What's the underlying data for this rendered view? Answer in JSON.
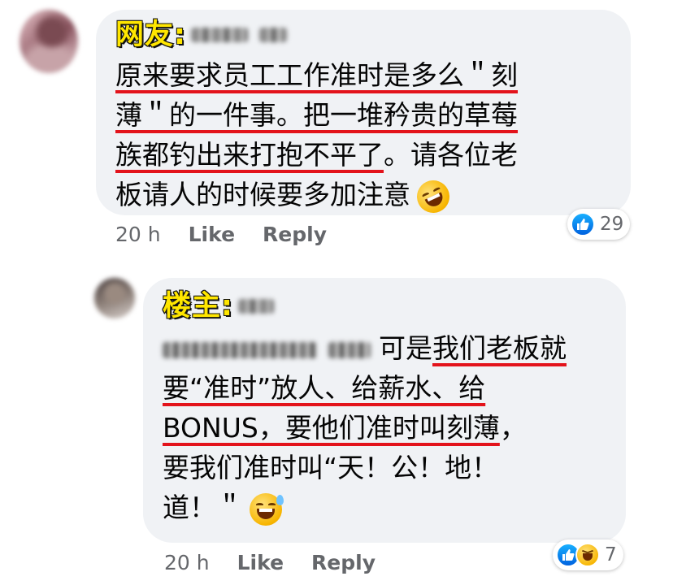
{
  "comments": [
    {
      "label": "网友:",
      "lines": [
        [
          "原来要求员工工作准时是多么＂刻"
        ],
        [
          "薄＂的一件事。把一堆矜贵的草莓"
        ],
        [
          "族都钓出来打抱不平了",
          "。请各位老"
        ],
        [
          "板请人的时候要多加注意"
        ]
      ],
      "emoji": "rolling-on-floor-laughing-emoji",
      "time": "20 h",
      "like_label": "Like",
      "reply_label": "Reply",
      "reaction_count": "29"
    },
    {
      "label": "楼主:",
      "lines": [
        [
          "可是",
          "我们老板就"
        ],
        [
          "要“准时”放人、给薪水、给"
        ],
        [
          "BONUS，要他们准时叫刻薄",
          "，"
        ],
        [
          "要我们准时叫“天！公！地！"
        ],
        [
          "道！＂"
        ]
      ],
      "emoji": "grinning-sweat-emoji",
      "time": "20 h",
      "like_label": "Like",
      "reply_label": "Reply",
      "reaction_count": "7"
    }
  ],
  "colors": {
    "bubble": "#f0f2f5",
    "underline": "#e3131b",
    "label_fill": "#ffe600",
    "meta_text": "#65676b",
    "like_blue": "#0062df"
  }
}
